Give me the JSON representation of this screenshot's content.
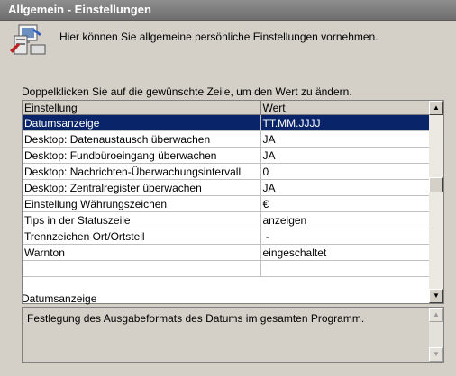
{
  "window": {
    "title": "Allgemein - Einstellungen"
  },
  "intro_text": "Hier können Sie allgemeine persönliche Einstellungen vornehmen.",
  "instruction": "Doppelklicken Sie auf die gewünschte Zeile, um den Wert zu ändern.",
  "table": {
    "columns": [
      "Einstellung",
      "Wert"
    ],
    "rows": [
      {
        "setting": "Datumsanzeige",
        "value": "TT.MM.JJJJ",
        "selected": true
      },
      {
        "setting": "Desktop: Datenaustausch überwachen",
        "value": "JA"
      },
      {
        "setting": "Desktop: Fundbüroeingang überwachen",
        "value": "JA"
      },
      {
        "setting": "Desktop: Nachrichten-Überwachungsintervall",
        "value": "0"
      },
      {
        "setting": "Desktop: Zentralregister überwachen",
        "value": "JA"
      },
      {
        "setting": "Einstellung Währungszeichen",
        "value": "€"
      },
      {
        "setting": "Tips in der Statuszeile",
        "value": "anzeigen"
      },
      {
        "setting": "Trennzeichen Ort/Ortsteil",
        "value": " -"
      },
      {
        "setting": "Warnton",
        "value": "eingeschaltet"
      },
      {
        "setting": "",
        "value": ""
      }
    ]
  },
  "description": {
    "label": "Datumsanzeige",
    "text": "Festlegung des Ausgabeformats des Datums im gesamten Programm."
  },
  "icons": {
    "app": "settings-computer-icon",
    "scroll_up": "arrow-up-icon",
    "scroll_down": "arrow-down-icon"
  },
  "colors": {
    "title_bar": "#7a7a7a",
    "selection": "#0a246a",
    "dialog_bg": "#d4d0c8"
  }
}
